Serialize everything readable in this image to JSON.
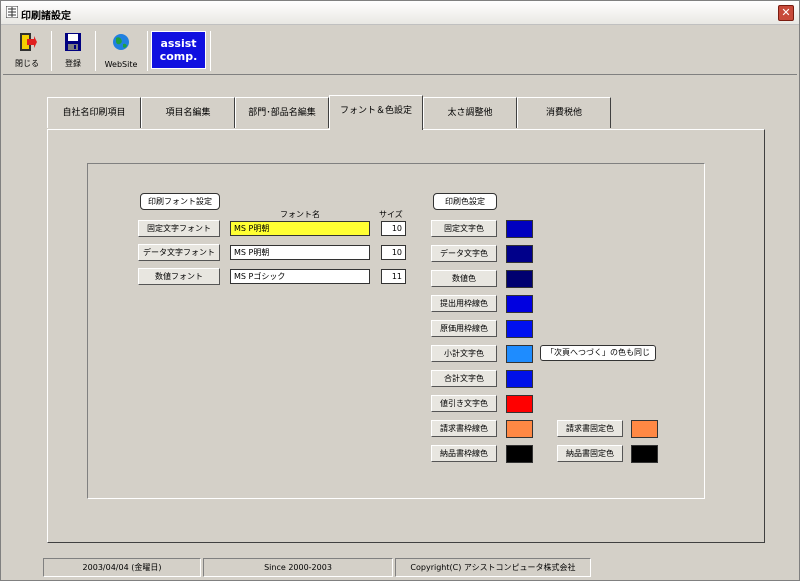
{
  "window": {
    "title": "印刷諸設定",
    "close_label": "✕"
  },
  "toolbar": {
    "close_label": "閉じる",
    "register_label": "登録",
    "website_label": "WebSite",
    "logo_line1": "assist",
    "logo_line2": "comp."
  },
  "tabs": [
    {
      "label": "自社名印刷項目"
    },
    {
      "label": "項目名編集"
    },
    {
      "label": "部門･部品名編集"
    },
    {
      "label": "フォント＆色設定"
    },
    {
      "label": "太さ調整他"
    },
    {
      "label": "消費税他"
    }
  ],
  "font_settings": {
    "group_label": "印刷フォント設定",
    "font_name_header": "フォント名",
    "size_header": "サイズ",
    "rows": [
      {
        "button": "固定文字フォント",
        "font": "MS P明朝",
        "size": "10"
      },
      {
        "button": "データ文字フォント",
        "font": "MS P明朝",
        "size": "10"
      },
      {
        "button": "数値フォント",
        "font": "MS Pゴシック",
        "size": "11"
      }
    ]
  },
  "color_settings": {
    "group_label": "印刷色設定",
    "rows": [
      {
        "button": "固定文字色",
        "color": "#0000c0"
      },
      {
        "button": "データ文字色",
        "color": "#00008a"
      },
      {
        "button": "数値色",
        "color": "#000070"
      },
      {
        "button": "提出用枠線色",
        "color": "#0000e0"
      },
      {
        "button": "原価用枠線色",
        "color": "#0010f0"
      },
      {
        "button": "小計文字色",
        "color": "#1e8cff"
      },
      {
        "button": "合計文字色",
        "color": "#0010e8"
      },
      {
        "button": "値引き文字色",
        "color": "#ff0000"
      },
      {
        "button": "請求書枠線色",
        "color": "#ff8844"
      },
      {
        "button": "納品書枠線色",
        "color": "#000000"
      }
    ],
    "subtotal_note": "「次頁へつづく」の色も同じ",
    "invoice_fixed": {
      "button": "請求書固定色",
      "color": "#ff8844"
    },
    "delivery_fixed": {
      "button": "納品書固定色",
      "color": "#000000"
    }
  },
  "status": {
    "date": "2003/04/04 (金曜日)",
    "since": "Since 2000-2003",
    "copyright": "Copyright(C) アシストコンピュータ株式会社"
  }
}
